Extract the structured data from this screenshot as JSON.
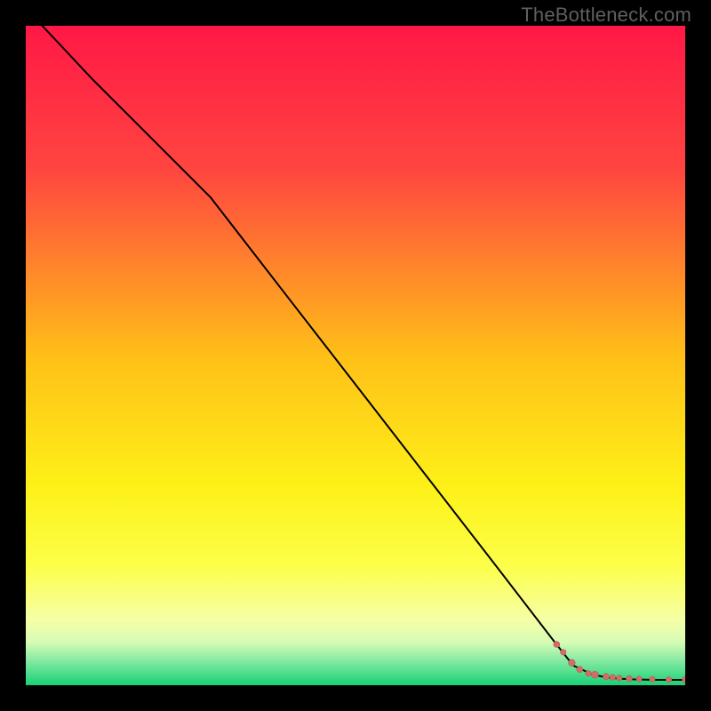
{
  "watermark": "TheBottleneck.com",
  "colors": {
    "line": "#000000",
    "marker_fill": "#cf6d66",
    "marker_stroke": "#c15a52",
    "background_black": "#000000"
  },
  "chart_data": {
    "type": "line",
    "title": "",
    "xlabel": "",
    "ylabel": "",
    "xlim": [
      0,
      100
    ],
    "ylim": [
      0,
      100
    ],
    "grid": false,
    "legend": false,
    "gradient_stops": [
      {
        "pos": 0.0,
        "color": "#ff1846"
      },
      {
        "pos": 0.22,
        "color": "#ff4640"
      },
      {
        "pos": 0.5,
        "color": "#ffbf18"
      },
      {
        "pos": 0.7,
        "color": "#fdf118"
      },
      {
        "pos": 0.82,
        "color": "#fcff4a"
      },
      {
        "pos": 0.9,
        "color": "#f6ffa5"
      },
      {
        "pos": 0.935,
        "color": "#d6fcb5"
      },
      {
        "pos": 0.965,
        "color": "#7fe8a0"
      },
      {
        "pos": 1.0,
        "color": "#18d277"
      }
    ],
    "series": [
      {
        "name": "curve",
        "x": [
          2.5,
          10,
          20,
          28,
          40,
          50,
          60,
          70,
          80,
          83,
          86,
          88,
          90,
          92,
          94,
          96,
          98,
          100
        ],
        "y": [
          100,
          92,
          82,
          74,
          58.5,
          45.6,
          32.7,
          19.8,
          6.8,
          3.0,
          1.6,
          1.2,
          1.0,
          0.9,
          0.85,
          0.8,
          0.8,
          0.8
        ]
      }
    ],
    "markers": {
      "name": "highlighted-points",
      "x": [
        80.5,
        81.5,
        82.8,
        84.0,
        85.3,
        86.3,
        88.0,
        89.0,
        90.0,
        91.5,
        93.0,
        95.0,
        97.5,
        100.0
      ],
      "y": [
        6.2,
        5.0,
        3.4,
        2.4,
        1.8,
        1.6,
        1.3,
        1.2,
        1.1,
        1.0,
        0.95,
        0.9,
        0.85,
        0.85
      ],
      "r": [
        3.5,
        3.2,
        3.8,
        3.5,
        3.2,
        4.0,
        3.5,
        3.2,
        3.2,
        3.5,
        3.2,
        3.2,
        3.2,
        3.5
      ]
    }
  }
}
